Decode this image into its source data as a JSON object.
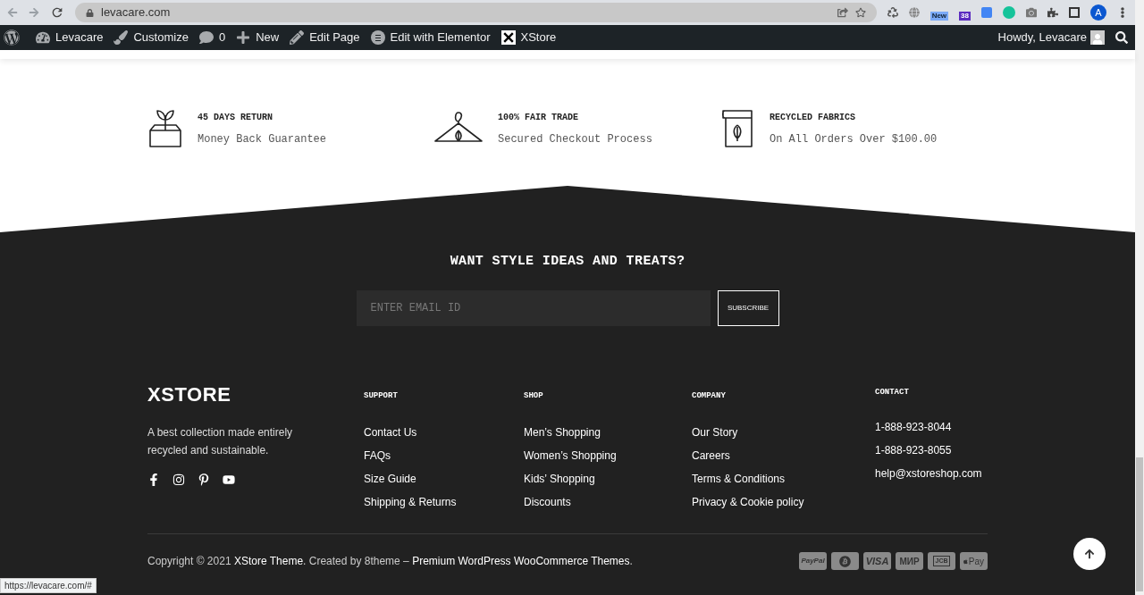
{
  "browser": {
    "url": "levacare.com",
    "extension_badges": [
      "New",
      "38"
    ],
    "profile": "A"
  },
  "admin_bar": {
    "items": [
      {
        "kind": "site",
        "label": "Levacare"
      },
      {
        "kind": "customize",
        "label": "Customize"
      },
      {
        "kind": "comments",
        "label": "0"
      },
      {
        "kind": "new",
        "label": "New"
      },
      {
        "kind": "edit",
        "label": "Edit Page"
      },
      {
        "kind": "elementor",
        "label": "Edit with Elementor"
      },
      {
        "kind": "xstore",
        "label": "XStore"
      }
    ],
    "greeting": "Howdy, Levacare"
  },
  "features": [
    {
      "kind": "plant-box",
      "title": "45 DAYS RETURN",
      "subtitle": "Money Back Guarantee"
    },
    {
      "kind": "hanger",
      "title": "100% FAIR TRADE",
      "subtitle": "Secured Checkout Process"
    },
    {
      "kind": "fabric-roll",
      "title": "RECYCLED FABRICS",
      "subtitle": "On All Orders Over $100.00"
    }
  ],
  "newsletter": {
    "heading": "WANT STYLE IDEAS AND TREATS?",
    "placeholder": "ENTER EMAIL ID",
    "button": "SUBSCRIBE"
  },
  "footer": {
    "brand": "XSTORE",
    "description": "A best collection made entirely recycled and sustainable.",
    "social": [
      {
        "kind": "facebook"
      },
      {
        "kind": "instagram"
      },
      {
        "kind": "pinterest"
      },
      {
        "kind": "youtube"
      }
    ],
    "columns": [
      {
        "title": "SUPPORT",
        "links": [
          "Contact Us",
          "FAQs",
          "Size Guide",
          "Shipping & Returns"
        ]
      },
      {
        "title": "SHOP",
        "links": [
          "Men’s Shopping",
          "Women’s Shopping",
          "Kids’ Shopping",
          "Discounts"
        ]
      },
      {
        "title": "COMPANY",
        "links": [
          "Our Story",
          "Careers",
          "Terms & Conditions",
          "Privacy & Cookie policy"
        ]
      }
    ],
    "contact": {
      "title": "CONTACT",
      "items": [
        "1-888-923-8044",
        "1-888-923-8055",
        "help@xstoreshop.com"
      ]
    },
    "copyright": "Copyright © 2021 **XStore Theme**. Created by 8theme – **Premium WordPress WooCommerce Themes**.",
    "payments": [
      {
        "kind": "paypal",
        "label": "PayPal"
      },
      {
        "kind": "bitcoin"
      },
      {
        "kind": "visa",
        "label": "VISA"
      },
      {
        "kind": "mir",
        "label": "МИР"
      },
      {
        "kind": "jcb",
        "label": "JCB"
      },
      {
        "kind": "applepay",
        "label": "Pay"
      }
    ]
  },
  "status_url": "https://levacare.com/#"
}
